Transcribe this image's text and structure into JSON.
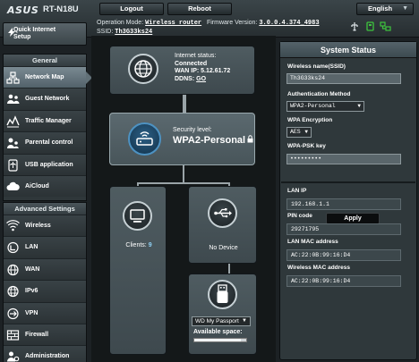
{
  "brand": {
    "logo": "ASUS",
    "model": "RT-N18U"
  },
  "top_buttons": {
    "logout": "Logout",
    "reboot": "Reboot",
    "language": "English"
  },
  "sysinfo": {
    "mode_label": "Operation Mode:",
    "mode_value": "Wireless router",
    "firmware_label": "Firmware Version:",
    "firmware_value": "3.0.0.4.374_4983",
    "ssid_label": "SSID:",
    "ssid_value": "Th3G33ks24"
  },
  "status_icons": [
    "usb-status-icon",
    "printer-status-icon",
    "network-status-icon"
  ],
  "quick_setup": {
    "line1": "Quick Internet",
    "line2": "Setup"
  },
  "nav": {
    "general_title": "General",
    "general": [
      {
        "label": "Network Map",
        "icon": "network-map-icon",
        "active": true
      },
      {
        "label": "Guest Network",
        "icon": "guest-network-icon"
      },
      {
        "label": "Traffic Manager",
        "icon": "traffic-manager-icon"
      },
      {
        "label": "Parental control",
        "icon": "parental-control-icon"
      },
      {
        "label": "USB application",
        "icon": "usb-application-icon"
      },
      {
        "label": "AiCloud",
        "icon": "aicloud-icon"
      }
    ],
    "advanced_title": "Advanced Settings",
    "advanced": [
      {
        "label": "Wireless",
        "icon": "wireless-icon"
      },
      {
        "label": "LAN",
        "icon": "lan-icon"
      },
      {
        "label": "WAN",
        "icon": "wan-icon"
      },
      {
        "label": "IPv6",
        "icon": "ipv6-icon"
      },
      {
        "label": "VPN",
        "icon": "vpn-icon"
      },
      {
        "label": "Firewall",
        "icon": "firewall-icon"
      },
      {
        "label": "Administration",
        "icon": "administration-icon"
      }
    ]
  },
  "map": {
    "internet": {
      "status_label": "Internet status:",
      "status_value": "Connected",
      "wan_ip": "WAN IP: 5.12.61.72",
      "ddns_label": "DDNS:",
      "ddns_value": "GO"
    },
    "router": {
      "security_label": "Security level:",
      "security_value": "WPA2-Personal"
    },
    "clients": {
      "label": "Clients:",
      "count": "9"
    },
    "usb": {
      "label": "No Device"
    },
    "storage": {
      "device": "WD My Passport",
      "space_label": "Available space:",
      "space_fraction": 0.9
    }
  },
  "system_status": {
    "title": "System Status",
    "ssid_label": "Wireless name(SSID)",
    "ssid_value": "Th3G33ks24",
    "auth_label": "Authentication Method",
    "auth_value": "WPA2-Personal",
    "enc_label": "WPA Encryption",
    "enc_value": "AES",
    "psk_label": "WPA-PSK key",
    "psk_value": "•••••••••",
    "apply": "Apply",
    "lan_ip_label": "LAN IP",
    "lan_ip_value": "192.168.1.1",
    "pin_label": "PIN code",
    "pin_value": "29271795",
    "lan_mac_label": "LAN MAC address",
    "lan_mac_value": "AC:22:0B:99:16:D4",
    "wl_mac_label": "Wireless MAC address",
    "wl_mac_value": "AC:22:0B:99:16:D4"
  }
}
